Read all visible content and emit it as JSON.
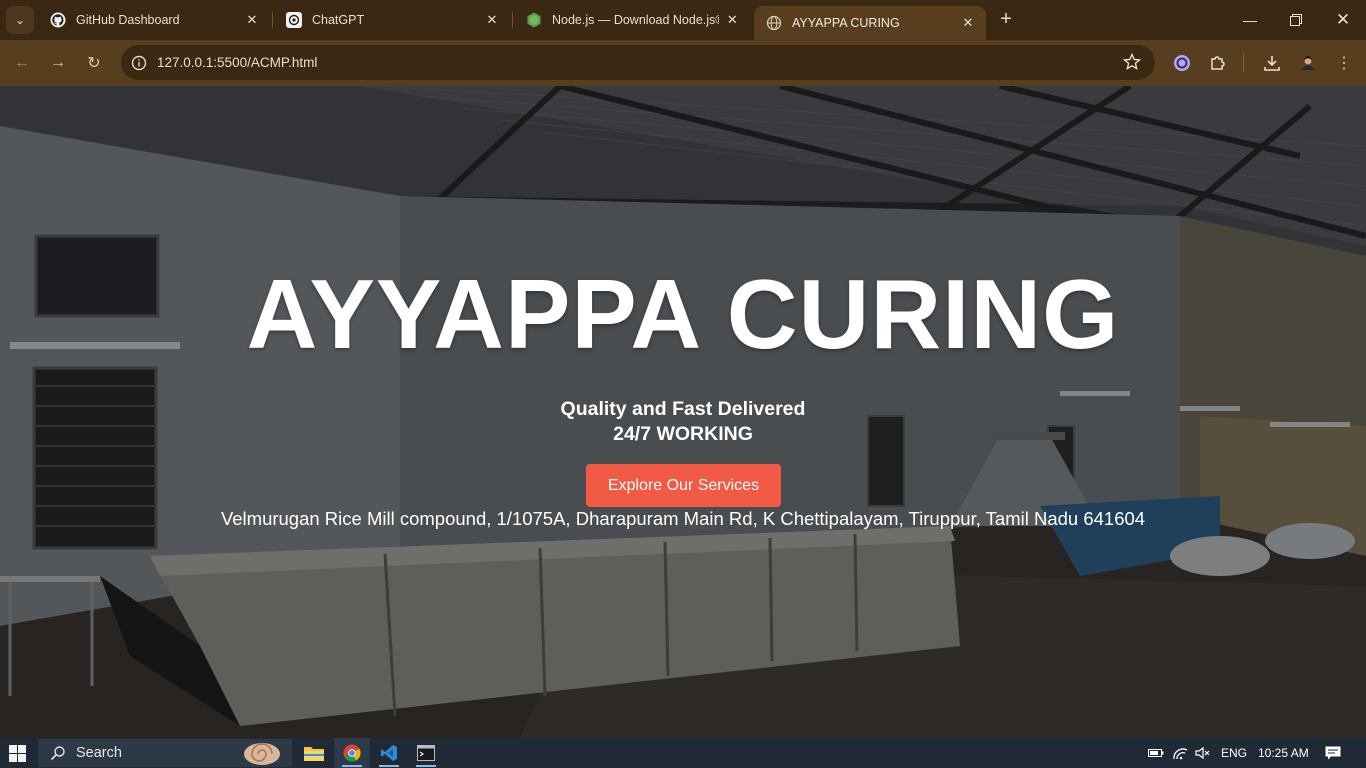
{
  "browser": {
    "tabs": [
      {
        "title": "GitHub Dashboard",
        "favicon": "github-icon",
        "active": false
      },
      {
        "title": "ChatGPT",
        "favicon": "chatgpt-icon",
        "active": false
      },
      {
        "title": "Node.js — Download Node.js®",
        "favicon": "nodejs-icon",
        "active": false
      },
      {
        "title": "AYYAPPA CURING",
        "favicon": "globe-icon",
        "active": true
      }
    ],
    "url": "127.0.0.1:5500/ACMP.html",
    "colors": {
      "frame": "#3a2812",
      "toolbar": "#573e1f"
    }
  },
  "page": {
    "title": "AYYAPPA CURING",
    "tagline_line1": "Quality and Fast Delivered",
    "tagline_line2": "24/7 WORKING",
    "cta_label": "Explore Our Services",
    "address": "Velmurugan Rice Mill compound, 1/1075A, Dharapuram Main Rd, K Chettipalayam, Tiruppur, Tamil Nadu 641604",
    "colors": {
      "cta": "#f25a45",
      "title": "#ffffff"
    }
  },
  "taskbar": {
    "search_label": "Search",
    "apps": [
      "file-explorer-icon",
      "chrome-icon",
      "vscode-icon",
      "terminal-icon"
    ],
    "language": "ENG",
    "time": "10:25 AM"
  }
}
